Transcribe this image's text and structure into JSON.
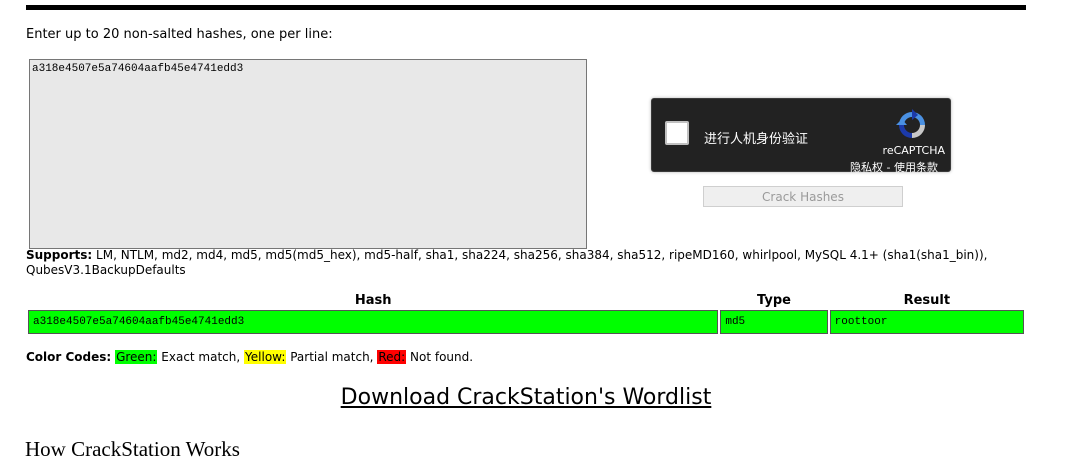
{
  "instructions": "Enter up to 20 non-salted hashes, one per line:",
  "hash_input": {
    "value": "a318e4507e5a74604aafb45e4741edd3"
  },
  "recaptcha": {
    "checkbox_label": "进行人机身份验证",
    "brand": "reCAPTCHA",
    "terms": "隐私权 - 使用条款",
    "icon": "recaptcha-logo-icon"
  },
  "crack_button_label": "Crack Hashes",
  "supports": {
    "label": "Supports:",
    "list": "LM, NTLM, md2, md4, md5, md5(md5_hex), md5-half, sha1, sha224, sha256, sha384, sha512, ripeMD160, whirlpool, MySQL 4.1+ (sha1(sha1_bin)), QubesV3.1BackupDefaults"
  },
  "results_table": {
    "headers": [
      "Hash",
      "Type",
      "Result"
    ],
    "rows": [
      {
        "hash": "a318e4507e5a74604aafb45e4741edd3",
        "type": "md5",
        "result": "roottoor",
        "status_color": "#00ff00"
      }
    ]
  },
  "color_codes": {
    "label": "Color Codes:",
    "green": {
      "name": "Green:",
      "desc": "Exact match,",
      "color": "#00ff00"
    },
    "yellow": {
      "name": "Yellow:",
      "desc": "Partial match,",
      "color": "#ffff00"
    },
    "red": {
      "name": "Red:",
      "desc": "Not found.",
      "color": "#ff0000"
    }
  },
  "download_link": "Download CrackStation's Wordlist",
  "section_heading": "How CrackStation Works"
}
